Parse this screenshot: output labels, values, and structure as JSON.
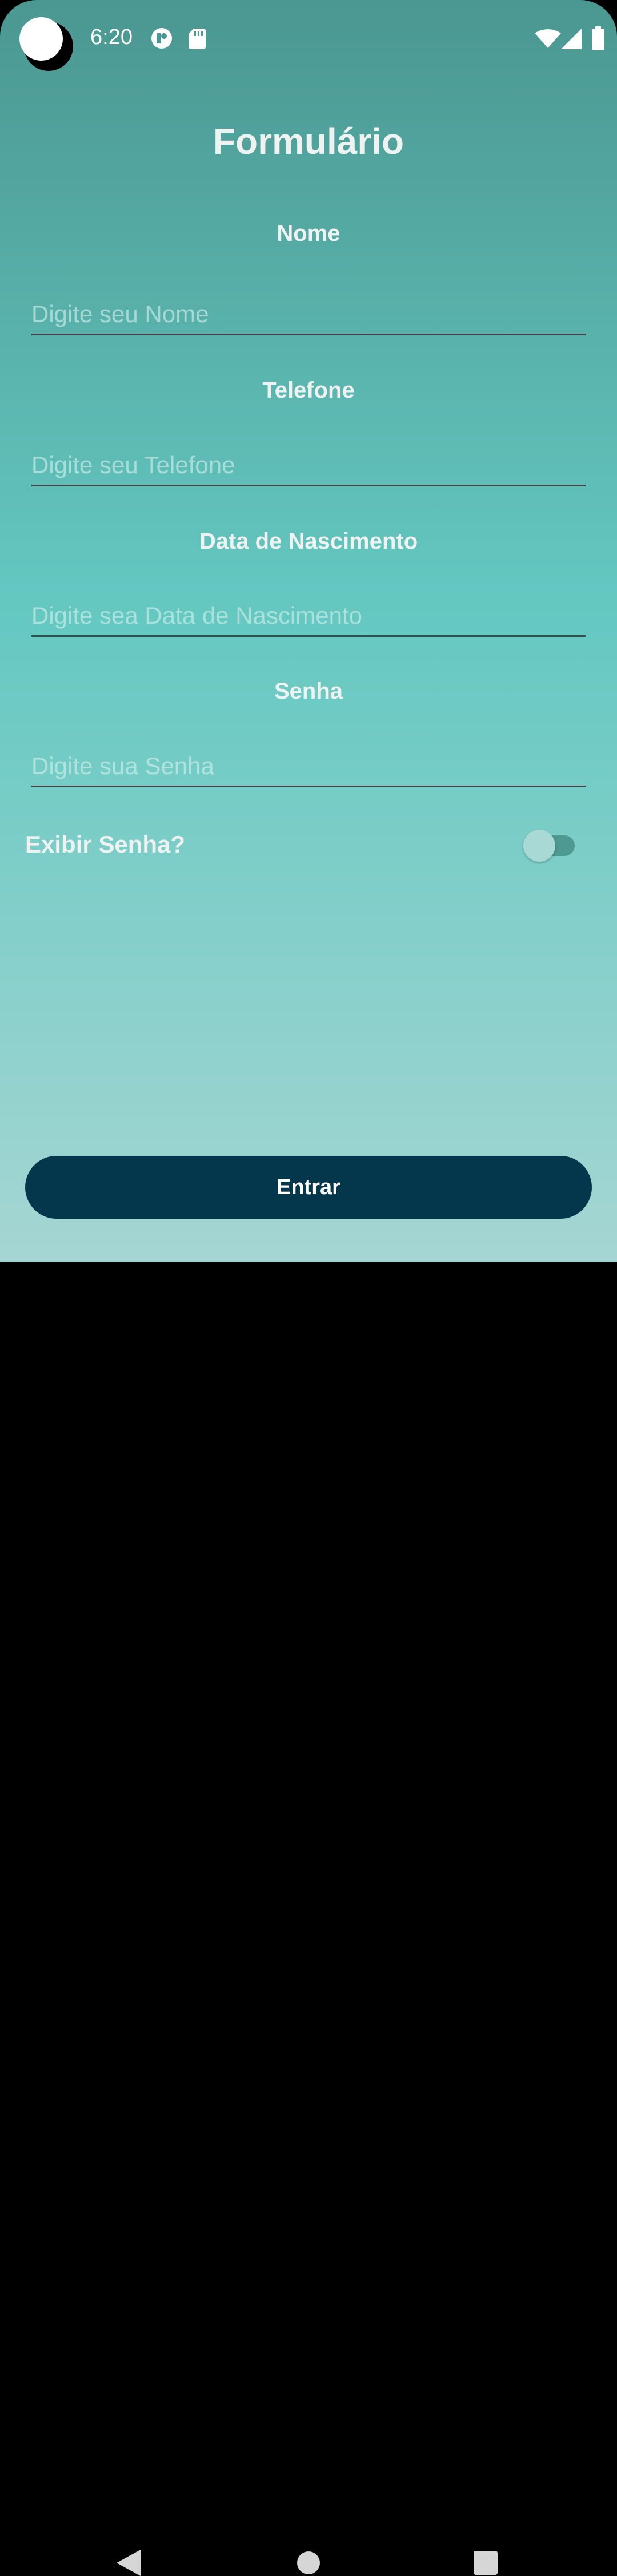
{
  "status_bar": {
    "time": "6:20",
    "icons": [
      "camera-cutout",
      "notification-app-icon",
      "sd-card-icon",
      "wifi-icon",
      "signal-icon",
      "battery-icon"
    ]
  },
  "form": {
    "title": "Formulário",
    "fields": [
      {
        "label": "Nome",
        "placeholder": "Digite seu Nome",
        "value": ""
      },
      {
        "label": "Telefone",
        "placeholder": "Digite seu Telefone",
        "value": ""
      },
      {
        "label": "Data de Nascimento",
        "placeholder": "Digite sea Data de Nascimento",
        "value": ""
      },
      {
        "label": "Senha",
        "placeholder": "Digite sua Senha",
        "value": ""
      }
    ],
    "show_password": {
      "label": "Exibir Senha?",
      "checked": false
    },
    "submit_label": "Entrar"
  },
  "navigation": {
    "buttons": [
      "back-icon",
      "home-icon",
      "recents-icon"
    ]
  },
  "colors": {
    "gradient_top": "#4b9791",
    "gradient_mid": "#64c8c1",
    "gradient_bottom": "#a5d6d3",
    "button": "#04374b",
    "text": "#eef3f2"
  }
}
